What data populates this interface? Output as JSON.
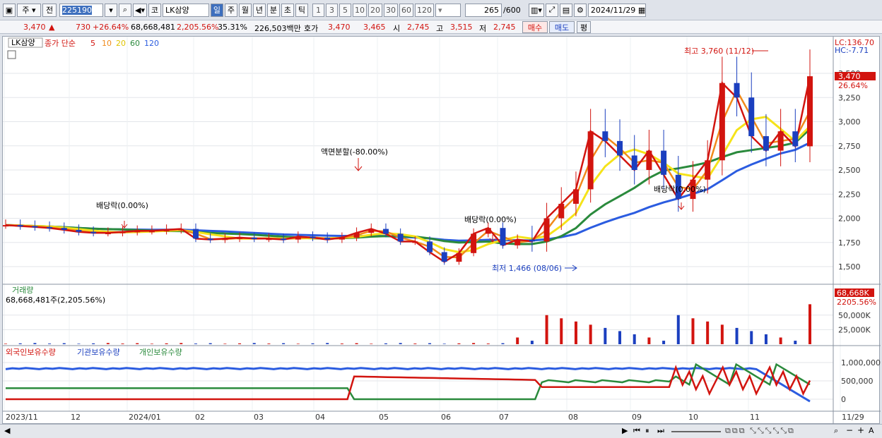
{
  "toolbar": {
    "period": "주",
    "prev": "전",
    "code": "225190",
    "stock_prefix": "코",
    "stock_name": "LK삼양",
    "period_tabs": [
      "일",
      "주",
      "월",
      "년",
      "분",
      "초",
      "틱"
    ],
    "active_tab": "일",
    "intervals": [
      "1",
      "3",
      "5",
      "10",
      "20",
      "30",
      "60",
      "120"
    ],
    "range_current": "265",
    "range_total": "/600",
    "date": "2024/11/29"
  },
  "quote": {
    "price": "3,470",
    "change": "730",
    "change_pct": "+26.64%",
    "volume": "68,668,481",
    "volume_pct": "2,205.56%",
    "turnover": "35.31%",
    "amount": "226,503백만",
    "ask_label": "호가",
    "ask": "3,470",
    "bid": "3,465",
    "open_label": "시",
    "open": "2,745",
    "high_label": "고",
    "high": "3,515",
    "low_label": "저",
    "low": "2,745",
    "buy": "매수",
    "sell": "매도",
    "eval": "평"
  },
  "price_panel": {
    "name": "LK삼양",
    "ma_title": "종가 단순",
    "ma_periods": [
      "5",
      "10",
      "20",
      "60",
      "120"
    ],
    "lc": "LC:136.70",
    "hc": "HC:-7.71",
    "last_price": "3,470",
    "last_pct": "26.64%",
    "y_ticks": [
      "3,500",
      "3,250",
      "3,000",
      "2,750",
      "2,500",
      "2,250",
      "2,000",
      "1,750",
      "1,500"
    ],
    "annotations": {
      "high": "최고 3,760 (11/12)",
      "low": "최저 1,466 (08/06)",
      "split": "액면분할(-80.00%)",
      "div1": "배당락(0.00%)",
      "div2": "배당락(0.00%)",
      "div3": "배당락(0.00%)"
    }
  },
  "volume_panel": {
    "title": "거래량",
    "value": "68,668,481주(2,205.56%)",
    "last": "68,668K",
    "last_pct": "2205.56%",
    "y_ticks": [
      "50,000K",
      "25,000K"
    ]
  },
  "holdings_panel": {
    "legend": [
      "외국인보유수량",
      "기관보유수량",
      "개인보유수량"
    ],
    "y_ticks": [
      "1,000,000",
      "500,000",
      "0"
    ]
  },
  "x_axis": [
    "2023/11",
    "12",
    "2024/01",
    "02",
    "03",
    "04",
    "05",
    "06",
    "07",
    "08",
    "09",
    "10",
    "11",
    "11/29"
  ],
  "colors": {
    "up": "#d2140f",
    "down": "#1b3fbf",
    "ma5": "#d2140f",
    "ma10": "#f08a1a",
    "ma20": "#f5e31a",
    "ma60": "#2a8a3c",
    "ma120": "#2b5ce0"
  },
  "chart_data": {
    "type": "candlestick",
    "instrument": "LK삼양",
    "period": "daily",
    "range": [
      "2023/11",
      "2024/11/29"
    ],
    "key_points": [
      {
        "date": "2024/08/06",
        "price": 1466,
        "label": "최저"
      },
      {
        "date": "2024/11/12",
        "price": 3760,
        "label": "최고"
      },
      {
        "date": "2024/11/29",
        "open": 2745,
        "high": 3515,
        "low": 2745,
        "close": 3470
      }
    ],
    "close_approx": [
      1930,
      1920,
      1910,
      1900,
      1880,
      1860,
      1850,
      1850,
      1860,
      1870,
      1870,
      1880,
      1890,
      1790,
      1780,
      1790,
      1800,
      1790,
      1790,
      1780,
      1810,
      1800,
      1780,
      1800,
      1850,
      1890,
      1840,
      1760,
      1760,
      1650,
      1550,
      1640,
      1840,
      1900,
      1720,
      1780,
      1760,
      2000,
      2150,
      2300,
      2900,
      2800,
      2650,
      2500,
      2700,
      2450,
      2200,
      2400,
      2600,
      3400,
      3250,
      2850,
      2700,
      2900,
      2745,
      3470
    ],
    "volume_ylim": [
      0,
      80000
    ],
    "volume_unit": "K"
  }
}
